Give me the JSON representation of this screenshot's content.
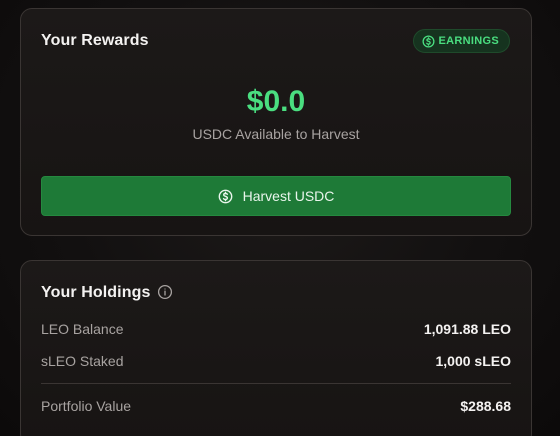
{
  "rewards": {
    "title": "Your Rewards",
    "badge_label": "EARNINGS",
    "badge_icon": "dollar-coin-icon",
    "amount": "$0.0",
    "amount_caption": "USDC Available to Harvest",
    "harvest_button_label": "Harvest USDC",
    "harvest_button_icon": "dollar-coin-icon"
  },
  "holdings": {
    "title": "Your Holdings",
    "info_icon": "info-icon",
    "rows": [
      {
        "label": "LEO Balance",
        "value": "1,091.88 LEO"
      },
      {
        "label": "sLEO Staked",
        "value": "1,000 sLEO"
      }
    ],
    "portfolio": {
      "label": "Portfolio Value",
      "value": "$288.68"
    }
  },
  "colors": {
    "accent_green": "#4ade80",
    "button_green": "#1e7a37",
    "card_border": "#3a3533",
    "muted_text": "#a8a3a1"
  }
}
